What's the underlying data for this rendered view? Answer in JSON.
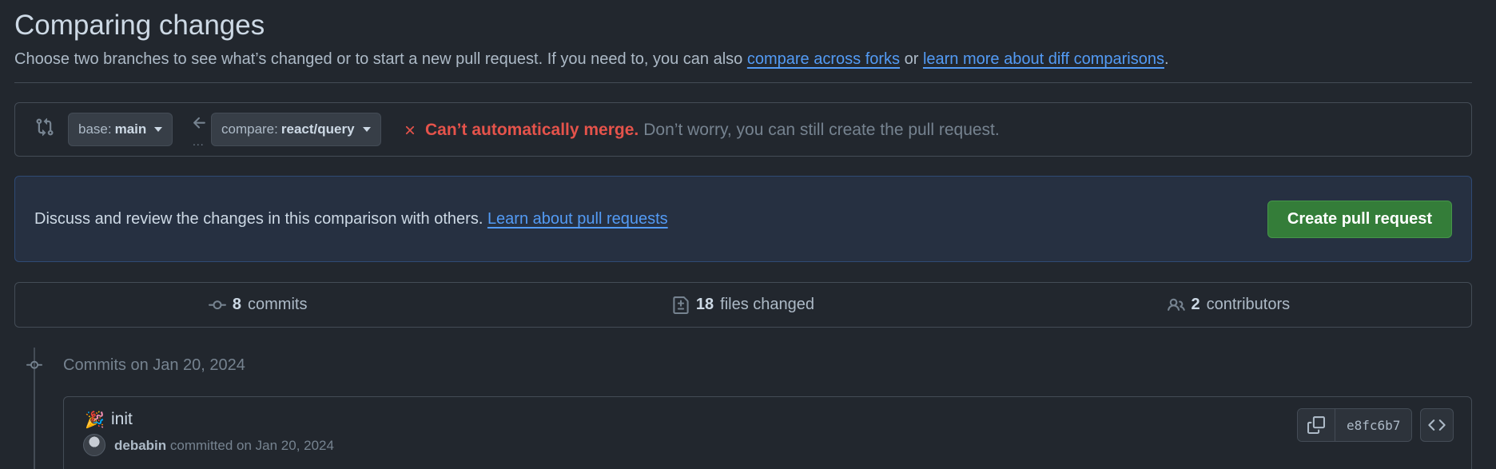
{
  "header": {
    "title": "Comparing changes",
    "subtitle_prefix": "Choose two branches to see what’s changed or to start a new pull request. If you need to, you can also ",
    "link_forks": "compare across forks",
    "subtitle_or": " or ",
    "link_learn_diff": "learn more about diff comparisons",
    "subtitle_suffix": "."
  },
  "range": {
    "base_prefix": "base:",
    "base_branch": "main",
    "compare_prefix": "compare:",
    "compare_branch": "react/query",
    "dots": "...",
    "merge_error": "Can’t automatically merge.",
    "merge_info": "Don’t worry, you can still create the pull request."
  },
  "prompt": {
    "text": "Discuss and review the changes in this comparison with others. ",
    "link": "Learn about pull requests",
    "button": "Create pull request"
  },
  "summary": {
    "commits_count": "8",
    "commits_label": "commits",
    "files_count": "18",
    "files_label": "files changed",
    "contributors_count": "2",
    "contributors_label": "contributors"
  },
  "timeline": {
    "date_heading": "Commits on Jan 20, 2024",
    "commit": {
      "emoji": "🎉",
      "title": "init",
      "author": "debabin",
      "meta": " committed on Jan 20, 2024",
      "sha": "e8fc6b7"
    }
  },
  "icons": {
    "compare": "git-compare-icon",
    "arrow": "arrow-left-icon",
    "merge_error": "x-icon",
    "commits": "git-commit-icon",
    "files": "file-diff-icon",
    "contributors": "people-icon",
    "copy": "copy-icon",
    "browse": "code-icon"
  },
  "colors": {
    "background": "#22272e",
    "accent_link": "#539bf5",
    "error": "#e5534b",
    "primary_button": "#347d39"
  }
}
